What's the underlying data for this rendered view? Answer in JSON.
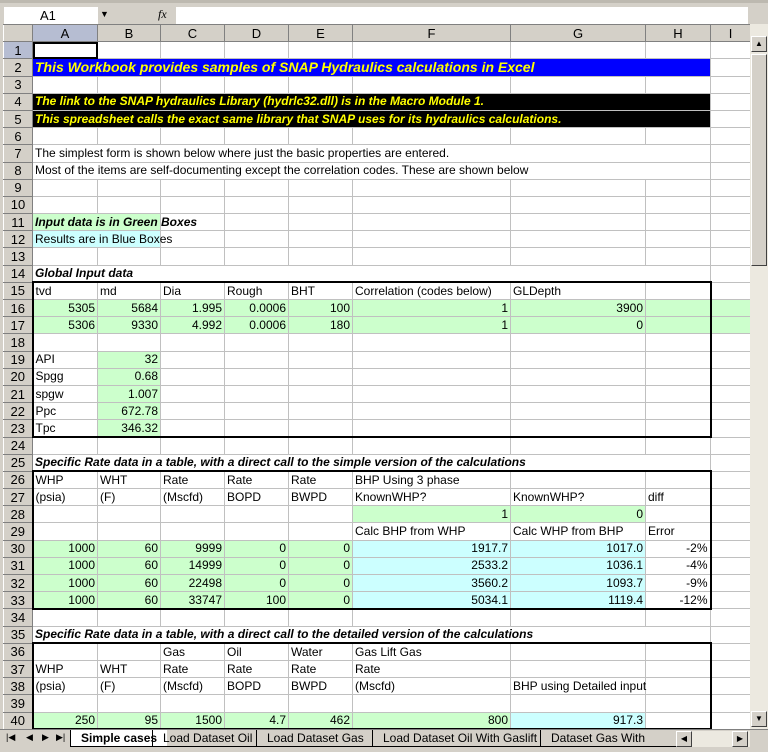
{
  "formula_bar": {
    "name_box": "A1",
    "fx": "fx",
    "formula": ""
  },
  "columns": [
    "A",
    "B",
    "C",
    "D",
    "E",
    "F",
    "G",
    "H",
    "I"
  ],
  "active_cell": "A1",
  "rows": [
    [
      ""
    ],
    [
      "This Workbook provides samples of SNAP Hydraulics calculations in Excel"
    ],
    [
      ""
    ],
    [
      "The link to the SNAP hydraulics Library (hydrlc32.dll) is in the Macro Module 1."
    ],
    [
      "This spreadsheet calls the exact same library that SNAP uses for its hydraulics calculations."
    ],
    [
      ""
    ],
    [
      "The simplest form is shown below where just the basic properties are entered."
    ],
    [
      "Most of the items are self-documenting except the correlation codes.  These are shown below"
    ],
    [
      ""
    ],
    [
      ""
    ],
    [
      "Input data is in Green Boxes"
    ],
    [
      "Results are in Blue Boxes"
    ],
    [
      ""
    ],
    [
      "Global Input data"
    ],
    [
      "tvd",
      "md",
      "Dia",
      "Rough",
      "BHT",
      "Correlation (codes below)",
      "GLDepth",
      ""
    ],
    [
      "5305",
      "5684",
      "1.995",
      "0.0006",
      "100",
      "1",
      "3900",
      ""
    ],
    [
      "5306",
      "9330",
      "4.992",
      "0.0006",
      "180",
      "1",
      "0",
      ""
    ],
    [
      ""
    ],
    [
      "API",
      "32"
    ],
    [
      "Spgg",
      "0.68"
    ],
    [
      "spgw",
      "1.007"
    ],
    [
      "Ppc",
      "672.78"
    ],
    [
      "Tpc",
      "346.32"
    ],
    [
      ""
    ],
    [
      "Specific Rate data in a table, with a direct call to the simple version of the calculations"
    ],
    [
      "WHP",
      "WHT",
      "Rate",
      "Rate",
      "Rate",
      "BHP Using 3 phase",
      "",
      ""
    ],
    [
      "(psia)",
      "(F)",
      "(Mscfd)",
      "BOPD",
      "BWPD",
      "KnownWHP?",
      "KnownWHP?",
      "diff"
    ],
    [
      "",
      "",
      "",
      "",
      "",
      "1",
      "0",
      ""
    ],
    [
      "",
      "",
      "",
      "",
      "",
      "Calc BHP from WHP",
      "Calc WHP from BHP",
      "Error"
    ],
    [
      "1000",
      "60",
      "9999",
      "0",
      "0",
      "1917.7",
      "1017.0",
      "-2%"
    ],
    [
      "1000",
      "60",
      "14999",
      "0",
      "0",
      "2533.2",
      "1036.1",
      "-4%"
    ],
    [
      "1000",
      "60",
      "22498",
      "0",
      "0",
      "3560.2",
      "1093.7",
      "-9%"
    ],
    [
      "1000",
      "60",
      "33747",
      "100",
      "0",
      "5034.1",
      "1119.4",
      "-12%"
    ],
    [
      ""
    ],
    [
      "Specific Rate data in a table, with a direct call to the detailed version of the calculations"
    ],
    [
      "",
      "",
      "Gas",
      "Oil",
      "Water",
      "Gas Lift Gas",
      "",
      ""
    ],
    [
      "WHP",
      "WHT",
      "Rate",
      "Rate",
      "Rate",
      "Rate",
      "",
      ""
    ],
    [
      "(psia)",
      "(F)",
      "(Mscfd)",
      "BOPD",
      "BWPD",
      "(Mscfd)",
      "BHP using Detailed input",
      ""
    ],
    [
      "",
      "",
      "",
      "",
      "",
      "",
      "",
      ""
    ],
    [
      "250",
      "95",
      "1500",
      "4.7",
      "462",
      "800",
      "917.3",
      ""
    ]
  ],
  "sheet_tabs": [
    "Simple cases",
    "Load Dataset Oil",
    "Load Dataset Gas",
    "Load Dataset Oil With Gaslift",
    "Dataset Gas With GasLi"
  ],
  "active_tab": "Simple cases"
}
